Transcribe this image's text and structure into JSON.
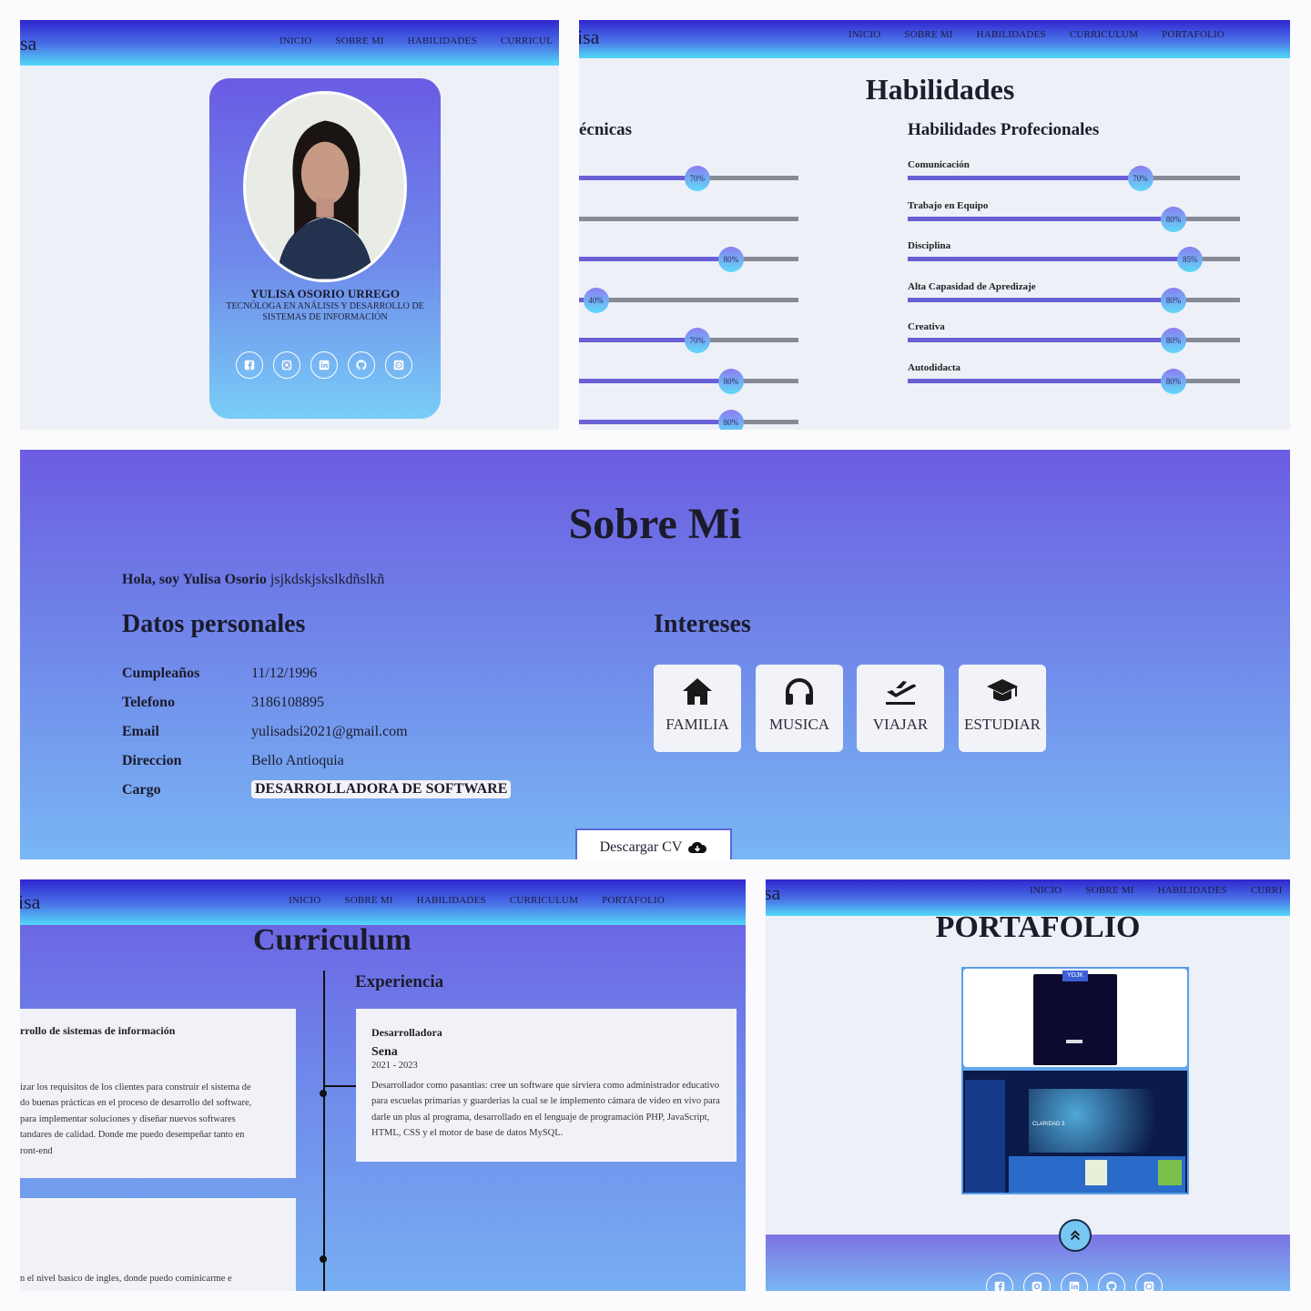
{
  "nav": {
    "brand_fragment": "sa",
    "brand_fragment_2": "isa",
    "links": [
      "INICIO",
      "SOBRE MI",
      "HABILIDADES",
      "CURRICULUM",
      "PORTAFOLIO"
    ],
    "links_clipped_1": "CURRICUL",
    "links_clipped_5": "CURRI"
  },
  "profile": {
    "name": "YULISA OSORIO URREGO",
    "title": "TECNÓLOGA EN ANÁLISIS Y DESARROLLO DE SISTEMAS DE INFORMACIÓN",
    "socials": [
      "facebook-icon",
      "instagram-icon",
      "linkedin-icon",
      "github-icon",
      "whatsapp-icon"
    ]
  },
  "skills": {
    "heading": "Habilidades",
    "technical_heading_fragment": "écnicas",
    "professional_heading": "Habilidades Profecionales",
    "technical": [
      {
        "label": "",
        "value": 70,
        "text": "70%"
      },
      {
        "label": "",
        "value": 0,
        "text": ""
      },
      {
        "label": "",
        "value": 80,
        "text": "80%"
      },
      {
        "label": "",
        "value": 40,
        "text": "40%"
      },
      {
        "label": "",
        "value": 70,
        "text": "70%"
      },
      {
        "label": "",
        "value": 80,
        "text": "80%"
      },
      {
        "label": "",
        "value": 80,
        "text": "80%"
      }
    ],
    "professional": [
      {
        "label": "Comunicación",
        "value": 70,
        "text": "70%"
      },
      {
        "label": "Trabajo en Equipo",
        "value": 80,
        "text": "80%"
      },
      {
        "label": "Disciplina",
        "value": 85,
        "text": "85%"
      },
      {
        "label": "Alta Capasidad de Apredizaje",
        "value": 80,
        "text": "80%"
      },
      {
        "label": "Creativa",
        "value": 80,
        "text": "80%"
      },
      {
        "label": "Autodidacta",
        "value": 80,
        "text": "80%"
      }
    ]
  },
  "about": {
    "heading": "Sobre Mi",
    "intro_bold": "Hola, soy Yulisa Osorio",
    "intro_rest": "jsjkdskjskslkdñslkñ",
    "personal_heading": "Datos personales",
    "interests_heading": "Intereses",
    "fields": [
      {
        "label": "Cumpleaños",
        "value": "11/12/1996"
      },
      {
        "label": "Telefono",
        "value": "3186108895"
      },
      {
        "label": "Email",
        "value": "yulisadsi2021@gmail.com"
      },
      {
        "label": "Direccion",
        "value": "Bello Antioquia"
      },
      {
        "label": "Cargo",
        "value": "DESARROLLADORA DE SOFTWARE"
      }
    ],
    "interests": [
      {
        "label": "FAMILIA",
        "icon": "home-icon"
      },
      {
        "label": "MUSICA",
        "icon": "headphones-icon"
      },
      {
        "label": "VIAJAR",
        "icon": "plane-departure-icon"
      },
      {
        "label": "ESTUDIAR",
        "icon": "graduation-cap-icon"
      }
    ],
    "download_label": "Descargar CV"
  },
  "curriculum": {
    "heading": "Curriculum",
    "experience_heading": "Experiencia",
    "education_card_title": "rrollo de sistemas de información",
    "education_card_text": [
      "izar los requisitos de los clientes para construir el sistema de",
      "do buenas prácticas en el proceso de desarrollo del software,",
      "para implementar soluciones y diseñar nuevos softwares",
      "tandares de calidad. Donde me puedo desempeñar tanto en",
      "ront-end"
    ],
    "education_card_2_text": "n el nivel basico de ingles, donde puedo cominicarme e",
    "experience": {
      "role": "Desarrolladora",
      "company": "Sena",
      "period": "2021 - 2023",
      "description": "Desarrollador como pasantias: cree un software que sirviera como administrador educativo para escuelas primarias y guarderias la cual se le implemento cámara de video en vivo para darle un plus al programa, desarrollado en el lenguaje de programación PHP, JavaScript, HTML, CSS y el motor de base de datos MySQL."
    }
  },
  "portfolio": {
    "heading": "PORTAFOLIO",
    "project_logo": "YDJK",
    "project_tile_text": "CLARIDAD 3"
  },
  "colors": {
    "accent_purple": "#6a5de2",
    "accent_cyan": "#5fdaf7",
    "bar_fill": "#6a60d6",
    "bar_track": "#858a95"
  }
}
